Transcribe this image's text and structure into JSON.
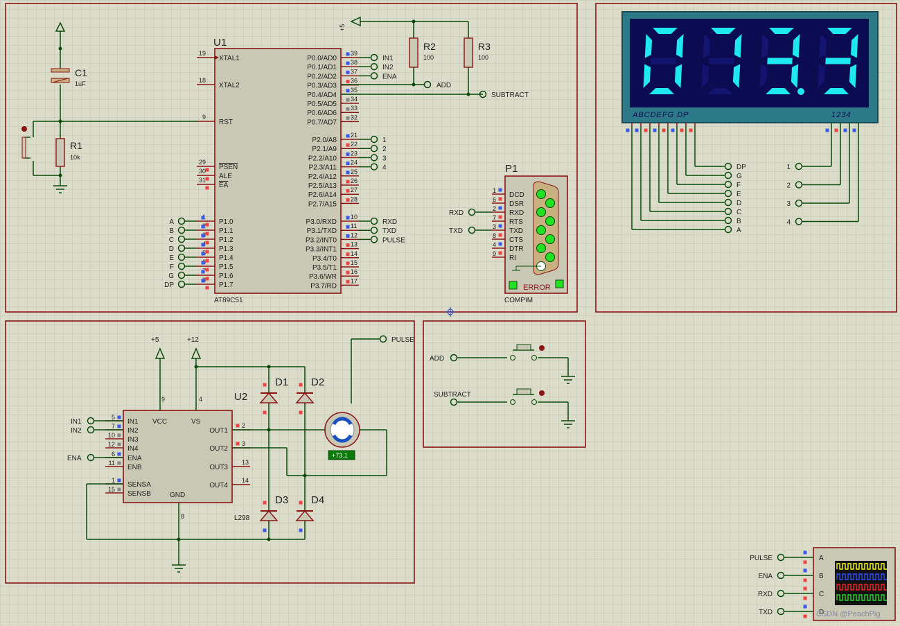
{
  "title": "",
  "mcu": {
    "ref": "U1",
    "model": "AT89C51",
    "left_pins": [
      {
        "n": "19",
        "name": "XTAL1"
      },
      {
        "n": "18",
        "name": "XTAL2"
      },
      {
        "n": "9",
        "name": "RST"
      },
      {
        "n": "29",
        "name": "PSEN"
      },
      {
        "n": "30",
        "name": "ALE"
      },
      {
        "n": "31",
        "name": "EA"
      },
      {
        "n": "1",
        "name": "P1.0"
      },
      {
        "n": "2",
        "name": "P1.1"
      },
      {
        "n": "3",
        "name": "P1.2"
      },
      {
        "n": "4",
        "name": "P1.3"
      },
      {
        "n": "5",
        "name": "P1.4"
      },
      {
        "n": "6",
        "name": "P1.5"
      },
      {
        "n": "7",
        "name": "P1.6"
      },
      {
        "n": "8",
        "name": "P1.7"
      }
    ],
    "right_pins": [
      {
        "n": "39",
        "name": "P0.0/AD0"
      },
      {
        "n": "38",
        "name": "P0.1/AD1"
      },
      {
        "n": "37",
        "name": "P0.2/AD2"
      },
      {
        "n": "36",
        "name": "P0.3/AD3"
      },
      {
        "n": "35",
        "name": "P0.4/AD4"
      },
      {
        "n": "34",
        "name": "P0.5/AD5"
      },
      {
        "n": "33",
        "name": "P0.6/AD6"
      },
      {
        "n": "32",
        "name": "P0.7/AD7"
      },
      {
        "n": "21",
        "name": "P2.0/A8"
      },
      {
        "n": "22",
        "name": "P2.1/A9"
      },
      {
        "n": "23",
        "name": "P2.2/A10"
      },
      {
        "n": "24",
        "name": "P2.3/A11"
      },
      {
        "n": "25",
        "name": "P2.4/A12"
      },
      {
        "n": "26",
        "name": "P2.5/A13"
      },
      {
        "n": "27",
        "name": "P2.6/A14"
      },
      {
        "n": "28",
        "name": "P2.7/A15"
      },
      {
        "n": "10",
        "name": "P3.0/RXD"
      },
      {
        "n": "11",
        "name": "P3.1/TXD"
      },
      {
        "n": "12",
        "name": "P3.2/INT0"
      },
      {
        "n": "13",
        "name": "P3.3/INT1"
      },
      {
        "n": "14",
        "name": "P3.4/T0"
      },
      {
        "n": "15",
        "name": "P3.5/T1"
      },
      {
        "n": "16",
        "name": "P3.6/WR"
      },
      {
        "n": "17",
        "name": "P3.7/RD"
      }
    ],
    "p1_labels": [
      "A",
      "B",
      "C",
      "D",
      "E",
      "F",
      "G",
      "DP"
    ],
    "p0_labels": [
      "IN1",
      "IN2",
      "ENA"
    ],
    "p2_labels": [
      "1",
      "2",
      "3",
      "4"
    ],
    "p3_labels": [
      "RXD",
      "TXD",
      "PULSE"
    ]
  },
  "parts": {
    "c1": {
      "ref": "C1",
      "value": "1uF"
    },
    "r1": {
      "ref": "R1",
      "value": "10k"
    },
    "r2": {
      "ref": "R2",
      "value": "100"
    },
    "r3": {
      "ref": "R3",
      "value": "100"
    },
    "vcc": "+5",
    "add": "ADD",
    "subtract": "SUBTRACT"
  },
  "compim": {
    "ref": "P1",
    "model": "COMPIM",
    "pins": [
      {
        "n": "1",
        "name": "DCD"
      },
      {
        "n": "6",
        "name": "DSR"
      },
      {
        "n": "2",
        "name": "RXD"
      },
      {
        "n": "7",
        "name": "RTS"
      },
      {
        "n": "3",
        "name": "TXD"
      },
      {
        "n": "8",
        "name": "CTS"
      },
      {
        "n": "4",
        "name": "DTR"
      },
      {
        "n": "9",
        "name": "RI"
      }
    ],
    "rxd": "RXD",
    "txd": "TXD",
    "error": "ERROR"
  },
  "display": {
    "digits": [
      "0",
      "7",
      "3",
      "3"
    ],
    "dp_after_index": 2,
    "segment_header": "ABCDEFG  DP",
    "digit_header": "1234",
    "segment_labels": [
      "DP",
      "G",
      "F",
      "E",
      "D",
      "C",
      "B",
      "A"
    ],
    "digit_labels": [
      "1",
      "2",
      "3",
      "4"
    ],
    "lit_color": "#1ee8f0",
    "body_color": "#2c7a88",
    "face_color": "#0b0b52"
  },
  "driver": {
    "ref": "U2",
    "model": "L298",
    "left_pins": [
      {
        "n": "5",
        "name": "IN1"
      },
      {
        "n": "7",
        "name": "IN2"
      },
      {
        "n": "10",
        "name": "IN3"
      },
      {
        "n": "12",
        "name": "IN4"
      },
      {
        "n": "6",
        "name": "ENA"
      },
      {
        "n": "11",
        "name": "ENB"
      },
      {
        "n": "1",
        "name": "SENSA"
      },
      {
        "n": "15",
        "name": "SENSB"
      }
    ],
    "right_pins": [
      {
        "n": "2",
        "name": "OUT1"
      },
      {
        "n": "3",
        "name": "OUT2"
      },
      {
        "n": "13",
        "name": "OUT3"
      },
      {
        "n": "14",
        "name": "OUT4"
      }
    ],
    "vcc": "VCC",
    "vs": "VS",
    "gnd": "GND",
    "pin_vcc": "9",
    "pin_vs": "4",
    "pin_gnd": "8",
    "supply_5": "+5",
    "supply_12": "+12",
    "in_labels": [
      "IN1",
      "IN2",
      "ENA"
    ],
    "pulse": "PULSE",
    "diodes": [
      "D1",
      "D2",
      "D3",
      "D4"
    ],
    "motor_readout": "+73.1"
  },
  "buttons": {
    "add": "ADD",
    "subtract": "SUBTRACT"
  },
  "scope": {
    "inputs": [
      {
        "net": "PULSE",
        "ch": "A"
      },
      {
        "net": "ENA",
        "ch": "B"
      },
      {
        "net": "RXD",
        "ch": "C"
      },
      {
        "net": "TXD",
        "ch": "D"
      }
    ],
    "trace_colors": [
      "#ffff00",
      "#3050ff",
      "#ff2020",
      "#20e020"
    ]
  },
  "watermark": "CSDN @PeachPig",
  "colors": {
    "wire": "#0a4a0a",
    "frame": "#8b1414",
    "chip": "#c8c8b4",
    "chip_border": "#8b1414",
    "pin_red": "#e04040",
    "pin_blue": "#3a5aef",
    "led": "#22e022"
  }
}
